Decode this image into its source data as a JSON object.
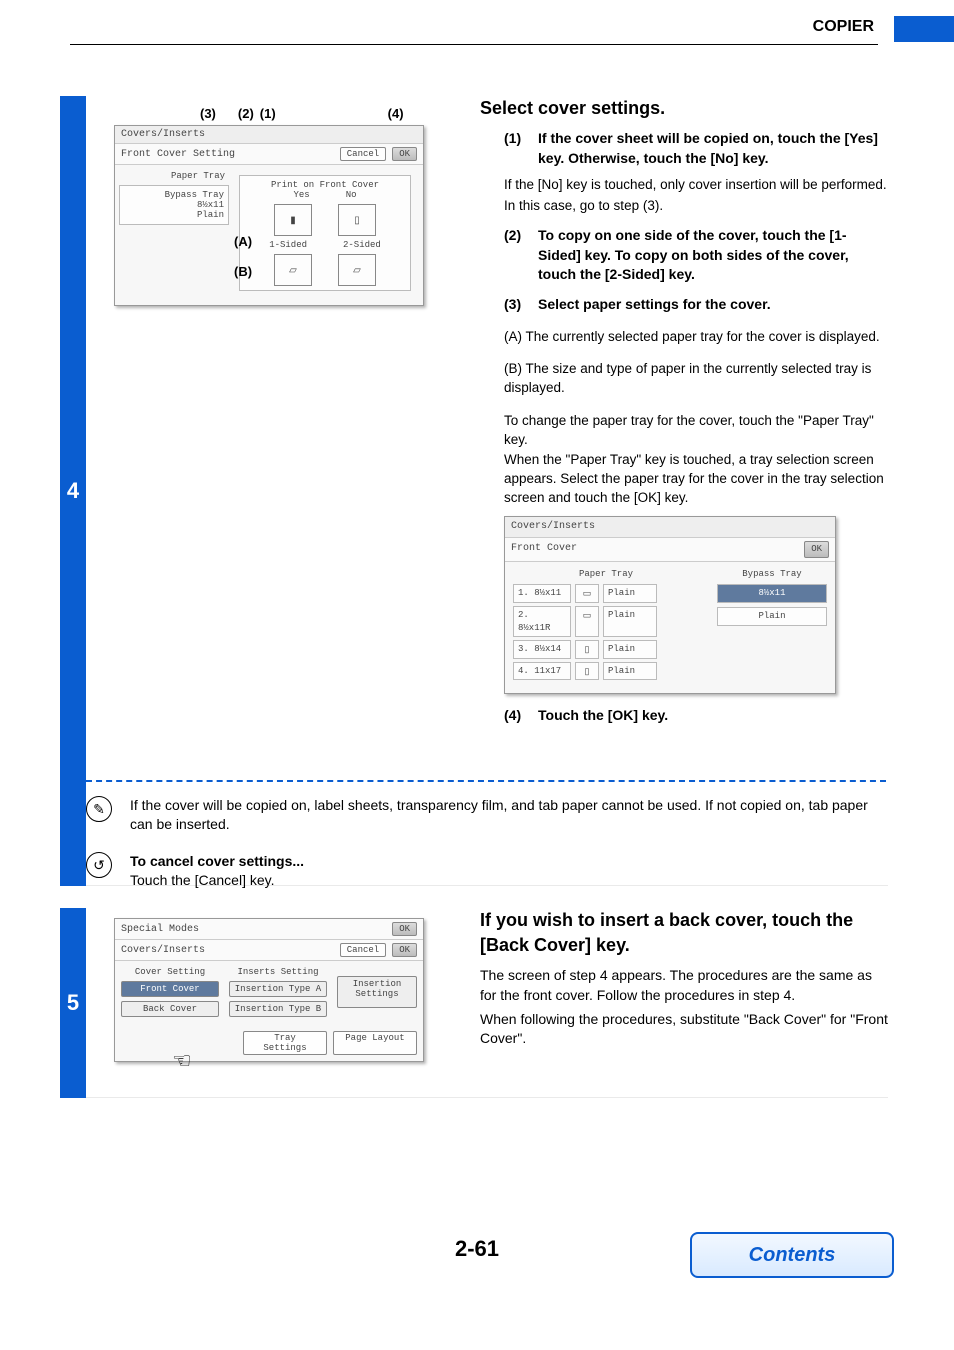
{
  "header": {
    "title": "COPIER"
  },
  "step4": {
    "number": "4",
    "heading": "Select cover settings.",
    "items": {
      "1": {
        "num": "(1)",
        "bold": "If the cover sheet will be copied on, touch the [Yes] key. Otherwise, touch the [No] key.",
        "p1": "If the [No] key is touched, only cover insertion will be performed.",
        "p2": "In this case, go to step (3)."
      },
      "2": {
        "num": "(2)",
        "bold": "To copy on one side of the cover, touch the [1-Sided] key. To copy on both sides of the cover, touch the [2-Sided] key."
      },
      "3": {
        "num": "(3)",
        "bold": "Select paper settings for the cover.",
        "a": "(A) The currently selected paper tray for the cover is displayed.",
        "b": "(B) The size and type of paper in the currently selected tray is displayed.",
        "p1": "To change the paper tray for the cover, touch the \"Paper Tray\" key.",
        "p2": "When the \"Paper Tray\" key is touched, a tray selection screen appears. Select the paper tray for the cover in the tray selection screen and touch the [OK] key."
      },
      "4": {
        "num": "(4)",
        "bold": "Touch the [OK] key."
      }
    },
    "fig1": {
      "callouts": {
        "c3": "(3)",
        "c2": "(2)",
        "c1": "(1)",
        "c4": "(4)"
      },
      "title": "Covers/Inserts",
      "subtitle": "Front Cover Setting",
      "cancel": "Cancel",
      "ok": "OK",
      "paper_tray_label": "Paper Tray",
      "bypass": "Bypass Tray",
      "size": "8½x11",
      "plain": "Plain",
      "print_title": "Print on Front Cover",
      "yes": "Yes",
      "no": "No",
      "one_sided": "1-Sided",
      "two_sided": "2-Sided",
      "a_label": "(A)",
      "b_label": "(B)"
    },
    "fig2": {
      "title": "Covers/Inserts",
      "subtitle": "Front Cover",
      "ok": "OK",
      "col1": "Paper Tray",
      "col2": "Bypass Tray",
      "rows": {
        "r1": {
          "name": "1. 8½x11",
          "type": "Plain"
        },
        "r2": {
          "name": "2. 8½x11R",
          "type": "Plain"
        },
        "r3": {
          "name": "3. 8½x14",
          "type": "Plain"
        },
        "r4": {
          "name": "4. 11x17",
          "type": "Plain"
        }
      },
      "bypass_size": "8½x11",
      "bypass_type": "Plain"
    }
  },
  "note1": "If the cover will be copied on, label sheets, transparency film, and tab paper cannot be used. If not copied on, tab paper can be inserted.",
  "note2": {
    "bold": "To cancel cover settings...",
    "text": "Touch the [Cancel] key."
  },
  "step5": {
    "number": "5",
    "heading": "If you wish to insert a back cover, touch the [Back Cover] key.",
    "p1": "The screen of step 4 appears. The procedures are the same as for the front cover. Follow the procedures in step 4.",
    "p2": "When following the procedures, substitute \"Back Cover\" for \"Front Cover\".",
    "fig": {
      "special": "Special Modes",
      "title": "Covers/Inserts",
      "ok": "OK",
      "cancel": "Cancel",
      "cover_setting": "Cover Setting",
      "inserts_setting": "Inserts Setting",
      "front_cover": "Front Cover",
      "back_cover": "Back Cover",
      "ins_a": "Insertion Type A",
      "ins_b": "Insertion Type B",
      "ins_settings": "Insertion Settings",
      "tray_settings": "Tray Settings",
      "page_layout": "Page Layout"
    }
  },
  "page_number": "2-61",
  "contents_label": "Contents"
}
